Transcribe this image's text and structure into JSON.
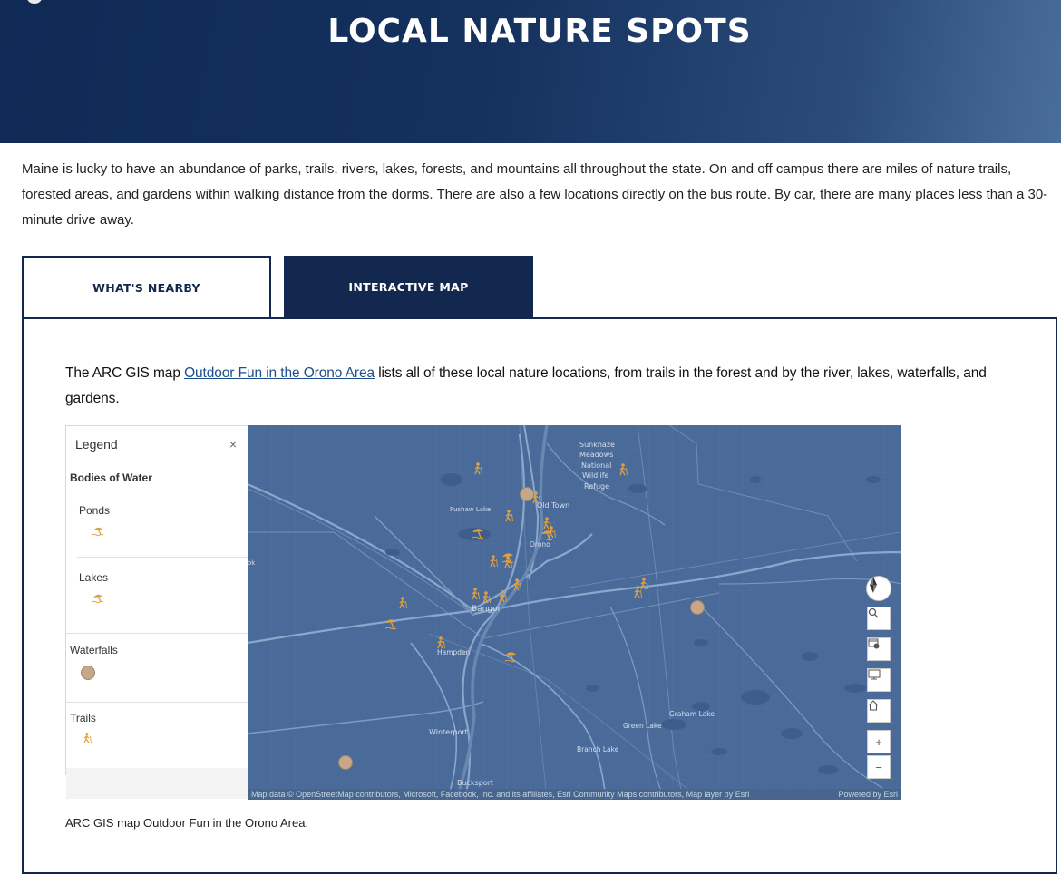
{
  "hero": {
    "title": "LOCAL NATURE SPOTS"
  },
  "intro": {
    "text": "Maine is lucky to have an abundance of parks, trails, rivers, lakes, forests, and mountains all throughout the state. On and off campus there are miles of nature trails, forested areas, and gardens within walking distance from the dorms. There are also a few locations directly on the bus route. By car, there are many places less than a 30-minute drive away."
  },
  "tabs": [
    {
      "label": "WHAT'S NEARBY",
      "active": false
    },
    {
      "label": "INTERACTIVE MAP",
      "active": true
    }
  ],
  "panel": {
    "text_before": "The ARC GIS map ",
    "link_text": "Outdoor Fun in the Orono Area",
    "text_after": " lists all of these local nature locations, from trails in the forest and by the river, lakes, waterfalls, and gardens.",
    "caption": "ARC GIS map Outdoor Fun in the Orono Area."
  },
  "legend": {
    "title": "Legend",
    "close": "×",
    "bodies_of_water": "Bodies of Water",
    "ponds": "Ponds",
    "lakes": "Lakes",
    "waterfalls": "Waterfalls",
    "trails": "Trails",
    "symbol_color": "#e0a040",
    "waterfall_color": "#c6a888"
  },
  "map": {
    "labels": {
      "sunkhaze_1": "Sunkhaze",
      "sunkhaze_2": "Meadows",
      "sunkhaze_3": "National",
      "sunkhaze_4": "Wildlife",
      "sunkhaze_5": "Refuge",
      "old_town": "Old Town",
      "pushaw": "Pushaw Lake",
      "orono": "Orono",
      "bangor": "Bangor",
      "hampden": "Hampden",
      "winterport": "Winterport",
      "green_lake": "Green Lake",
      "graham_lake": "Graham Lake",
      "branch_lake": "Branch Lake",
      "bucksport": "Bucksport",
      "edge_k": "ok"
    },
    "attribution": "Map data © OpenStreetMap contributors, Microsoft, Facebook, Inc. and its affiliates, Esri Community Maps contributors, Map layer by Esri",
    "powered_by": "Powered by Esri",
    "controls": {
      "compass": "compass-icon",
      "search": "search-icon",
      "basemap": "basemap-gallery-icon",
      "fullscreen": "fullscreen-icon",
      "home": "home-icon",
      "zoom_in": "+",
      "zoom_out": "−"
    },
    "colors": {
      "water_bg": "#4a6b9a",
      "roads": "#7d97bd",
      "accent": "#e0a040"
    }
  }
}
